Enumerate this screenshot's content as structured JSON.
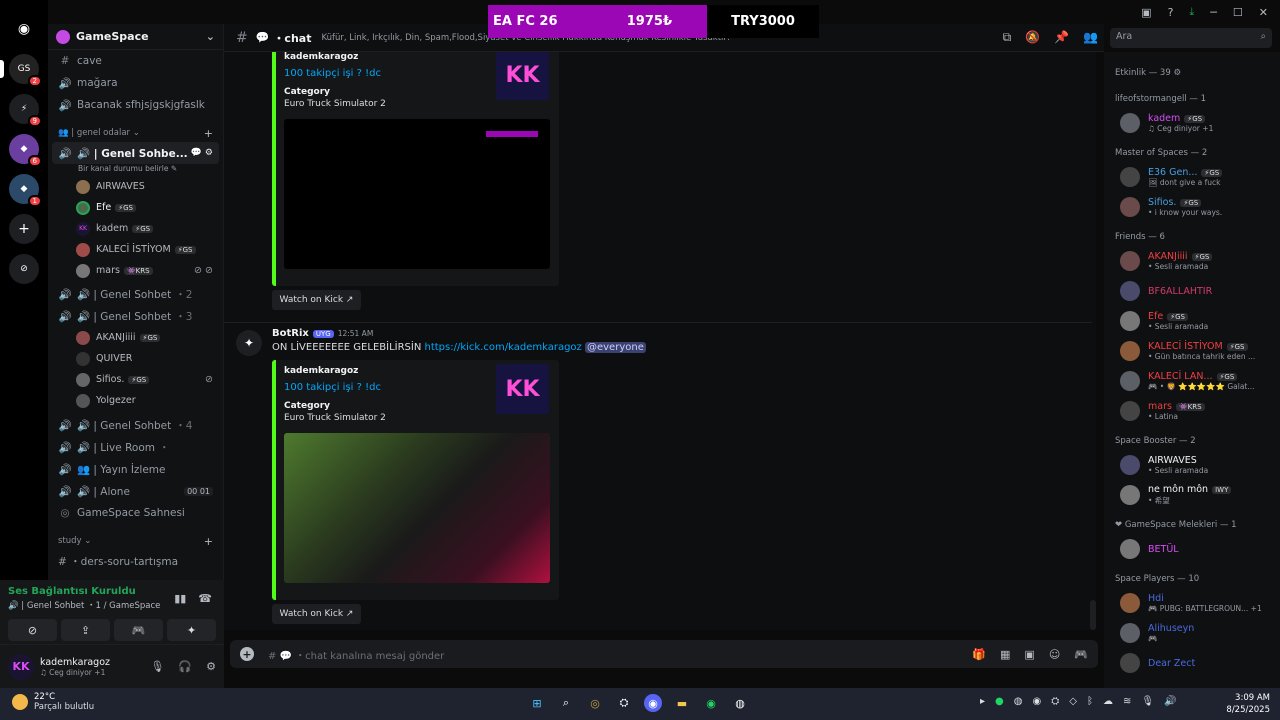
{
  "overlay": {
    "game": "EA FC 26",
    "price": "1975₺",
    "price2": "TRY3000"
  },
  "server": {
    "name": "GameSpace"
  },
  "rail_badges": [
    "2",
    "9",
    "6",
    "1"
  ],
  "channels_top": [
    {
      "icon": "#",
      "label": "cave"
    },
    {
      "icon": "🔊",
      "label": "mağara"
    },
    {
      "icon": "🔊",
      "label": "Bacanak sfhjsjgskjgfaslk"
    }
  ],
  "category_voice": "👥 | genel odalar ⌄",
  "selected_channel": {
    "label": "🔊 | Genel Sohbe...",
    "status": "Bir kanal durumu belirle ✎"
  },
  "genel_users": [
    {
      "name": "AIRWAVES",
      "tag": ""
    },
    {
      "name": "Efe",
      "tag": "⚡GS"
    },
    {
      "name": "kadem",
      "tag": "⚡GS"
    },
    {
      "name": "KALECİ İSTİYOM",
      "tag": "⚡GS"
    },
    {
      "name": "mars",
      "tag": "👾KRS"
    }
  ],
  "ch_gs2": {
    "label": "🔊 | Genel Sohbet",
    "count": "・2"
  },
  "ch_gs3": {
    "label": "🔊 | Genel Sohbet",
    "count": "・3"
  },
  "gs3_users": [
    {
      "name": "AKANJiiii",
      "tag": "⚡GS"
    },
    {
      "name": "QUIVER",
      "tag": ""
    },
    {
      "name": "Sifios.",
      "tag": "⚡GS"
    },
    {
      "name": "Yolgezer",
      "tag": ""
    }
  ],
  "channels_bottom": [
    {
      "icon": "🔊",
      "label": "🔊 | Genel Sohbet",
      "extra": "・4"
    },
    {
      "icon": "🔊",
      "label": "🔊 | Live Room",
      "extra": "・"
    },
    {
      "icon": "🔊",
      "label": "👥 | Yayın İzleme",
      "extra": ""
    },
    {
      "icon": "🔊",
      "label": "🔊 | Alone",
      "extra": "00  01"
    },
    {
      "icon": "◎",
      "label": "GameSpace Sahnesi",
      "extra": ""
    }
  ],
  "category_study": "study ⌄",
  "study_channel": "# ・ders-soru-tartışma",
  "voice_panel": {
    "connected": "Ses Bağlantısı Kuruldu",
    "location": "🔊 | Genel Sohbet ・1 / GameSpace"
  },
  "user_panel": {
    "initials": "KK",
    "name": "kademkaragoz",
    "status": "♫ Ceg diniyor +1"
  },
  "topbar": {
    "channel": "・chat",
    "topic": "Küfür, Link, Irkçılık, Din, Spam,Flood,Siyaset ve Cinsellik Hakkında Konuşmak Kesinlikle Yasaktır!"
  },
  "search": {
    "placeholder": "Ara"
  },
  "embeds": [
    {
      "author": "kademkaragoz",
      "link": "100 takipçi işi ? !dc",
      "field_label": "Category",
      "field_value": "Euro Truck Simulator 2",
      "thumb": "KK"
    },
    {
      "author": "kademkaragoz",
      "link": "100 takipçi işi ? !dc",
      "field_label": "Category",
      "field_value": "Euro Truck Simulator 2",
      "thumb": "KK"
    }
  ],
  "watch_label": "Watch on Kick ↗",
  "message": {
    "author": "BotRix",
    "tag": "UYG",
    "time": "12:51 AM",
    "text": "ON LİVEEEEEEE GELEBİLİRSİN",
    "url": "https://kick.com/kademkaragoz",
    "mention": "@everyone"
  },
  "composer": {
    "placeholder": "# 💬 ・chat kanalına mesaj gönder"
  },
  "members": {
    "activity": "Etkinlik — 39 ⚙",
    "groups": [
      {
        "title": "lifeofstormangell — 1",
        "items": [
          {
            "name": "kadem",
            "tag": "⚡GS",
            "status": "♫ Ceg diniyor +1",
            "color": "#d84cf5"
          }
        ]
      },
      {
        "title": "Master of Spaces — 2",
        "items": [
          {
            "name": "E36 Gen...",
            "tag": "⚡GS",
            "status": "🖼 dont give a fuck",
            "color": "#4a9fe0"
          },
          {
            "name": "Sifios.",
            "tag": "⚡GS",
            "status": "• i know your ways.",
            "color": "#4a9fe0"
          }
        ]
      },
      {
        "title": "Friends — 6",
        "items": [
          {
            "name": "AKANJiiii",
            "tag": "⚡GS",
            "status": "• Sesli aramada",
            "color": "#f23f43"
          },
          {
            "name": "BF6ALLAHTIR",
            "tag": "",
            "status": "",
            "color": "#d23a6a"
          },
          {
            "name": "Efe",
            "tag": "⚡GS",
            "status": "• Sesli aramada",
            "color": "#f23f43"
          },
          {
            "name": "KALECİ İSTİYOM",
            "tag": "⚡GS",
            "status": "• Gün batınca tahrik eden ...",
            "color": "#f23f43"
          },
          {
            "name": "KALECİ LAN...",
            "tag": "⚡GS",
            "status": "🎮 • 🦁 ⭐⭐⭐⭐⭐ Galat...",
            "color": "#f23f43"
          },
          {
            "name": "mars",
            "tag": "👾KRS",
            "status": "• Latina",
            "color": "#f23f43"
          }
        ]
      },
      {
        "title": "Space Booster — 2",
        "items": [
          {
            "name": "AIRWAVES",
            "tag": "",
            "status": "• Sesli aramada",
            "color": "#f2f3f5"
          },
          {
            "name": "ne môn môn",
            "tag": "IWY",
            "status": "• 希望",
            "color": "#f2f3f5"
          }
        ]
      },
      {
        "title": "❤ GameSpace Melekleri — 1",
        "items": [
          {
            "name": "BETÜL",
            "tag": "",
            "status": "",
            "color": "#d84cf5"
          }
        ]
      },
      {
        "title": "Space Players — 10",
        "items": [
          {
            "name": "Hdi",
            "tag": "",
            "status": "🎮 PUBG: BATTLEGROUN... +1",
            "color": "#4a6ae0"
          },
          {
            "name": "Alihuseyn",
            "tag": "",
            "status": "🎮",
            "color": "#4a6ae0"
          },
          {
            "name": "Dear Zect",
            "tag": "",
            "status": "",
            "color": "#4a6ae0"
          }
        ]
      }
    ]
  },
  "taskbar": {
    "temp": "22°C",
    "weather": "Parçalı bulutlu",
    "time": "3:09 AM",
    "date": "8/25/2025"
  }
}
